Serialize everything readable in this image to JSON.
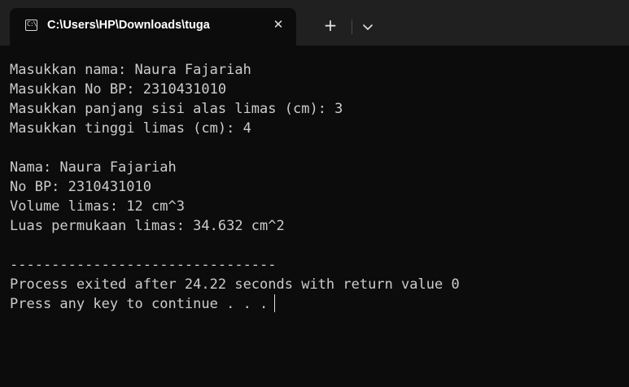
{
  "tab": {
    "icon": "terminal-icon",
    "icon_glyph": "C:\\",
    "title": "C:\\Users\\HP\\Downloads\\tuga",
    "close_glyph": "✕",
    "new_tab_glyph": "+",
    "dropdown_icon": "chevron-down-icon"
  },
  "terminal": {
    "lines": [
      "Masukkan nama: Naura Fajariah",
      "Masukkan No BP: 2310431010",
      "Masukkan panjang sisi alas limas (cm): 3",
      "Masukkan tinggi limas (cm): 4",
      "",
      "Nama: Naura Fajariah",
      "No BP: 2310431010",
      "Volume limas: 12 cm^3",
      "Luas permukaan limas: 34.632 cm^2",
      "",
      "--------------------------------",
      "Process exited after 24.22 seconds with return value 0",
      "Press any key to continue . . ."
    ]
  },
  "colors": {
    "terminal_bg": "#0c0c0c",
    "tabstrip_bg": "#202020",
    "text": "#cccccc"
  }
}
